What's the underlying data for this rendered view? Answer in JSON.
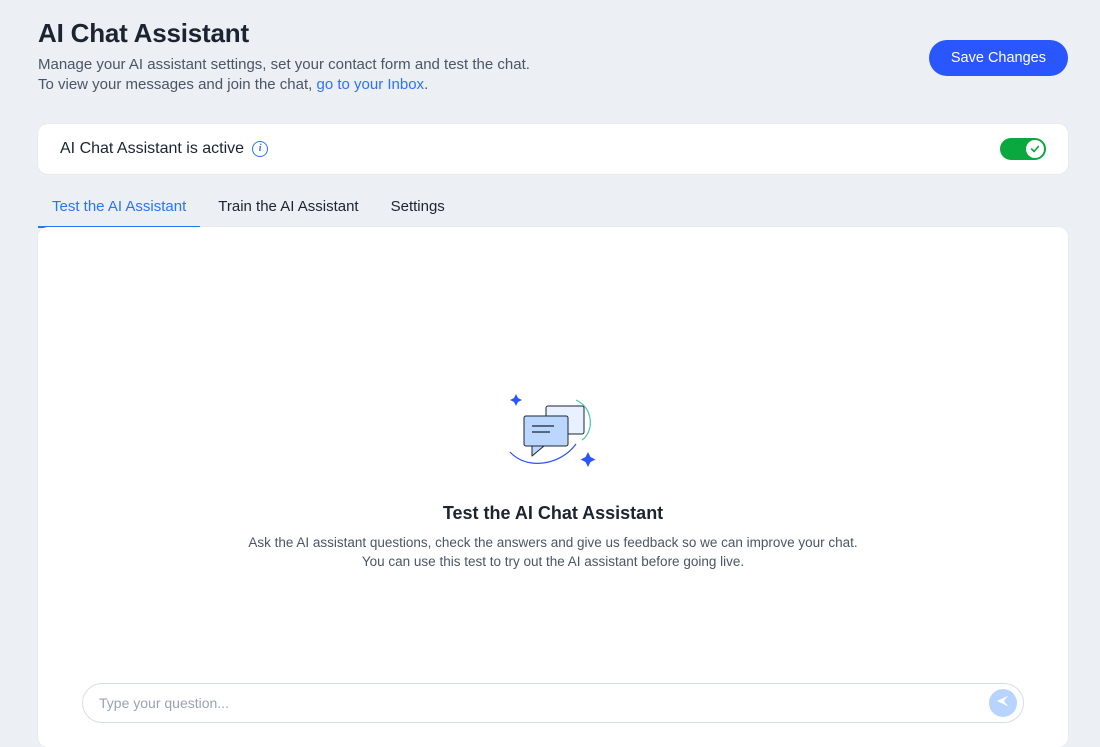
{
  "header": {
    "title": "AI Chat Assistant",
    "subtitle_line1": "Manage your AI assistant settings, set your contact form and test the chat.",
    "subtitle_line2_prefix": "To view your messages and join the chat, ",
    "inbox_link_text": "go to your Inbox",
    "subtitle_line2_suffix": ".",
    "save_button_label": "Save Changes"
  },
  "status": {
    "text": "AI Chat Assistant is active",
    "active": true,
    "info_glyph": "i"
  },
  "tabs": [
    {
      "id": "test",
      "label": "Test the AI Assistant",
      "active": true
    },
    {
      "id": "train",
      "label": "Train the AI Assistant",
      "active": false
    },
    {
      "id": "settings",
      "label": "Settings",
      "active": false
    }
  ],
  "empty_state": {
    "title": "Test the AI Chat Assistant",
    "desc_line1": "Ask the AI assistant questions, check the answers and give us feedback so we can improve your chat.",
    "desc_line2": "You can use this test to try out the AI assistant before going live."
  },
  "input": {
    "placeholder": "Type your question..."
  },
  "colors": {
    "accent_blue": "#2a73ff",
    "primary_button": "#2a56ff",
    "toggle_green": "#0aa83f",
    "send_button_bg": "#b7d3ff"
  }
}
